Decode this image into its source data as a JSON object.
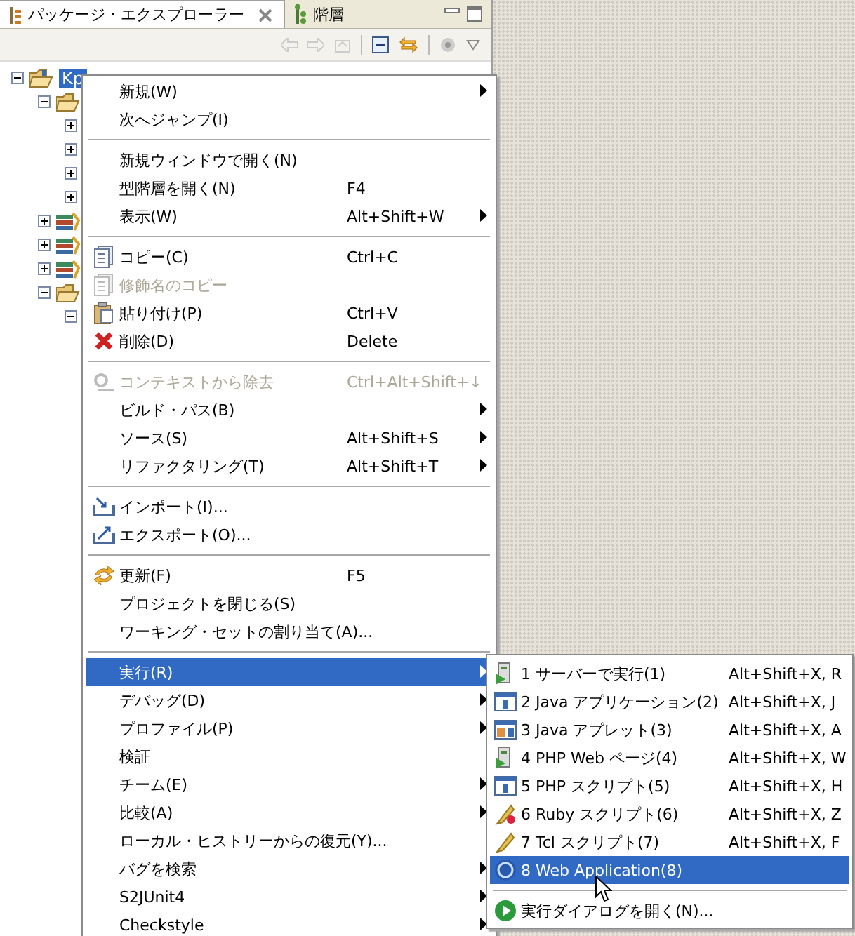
{
  "tabs": [
    {
      "label": "パッケージ・エクスプローラー",
      "selected": true,
      "closable": true
    },
    {
      "label": "階層",
      "selected": false,
      "closable": false
    }
  ],
  "tree": [
    {
      "label": "Kp",
      "kind": "project",
      "expanded": true,
      "selected": true,
      "children": [
        {
          "kind": "folder",
          "expanded": true,
          "children": [
            {
              "expanded": false
            },
            {
              "expanded": false
            },
            {
              "expanded": false
            },
            {
              "expanded": false
            }
          ]
        },
        {
          "kind": "library",
          "expanded": false
        },
        {
          "kind": "library",
          "expanded": false
        },
        {
          "kind": "library",
          "expanded": false
        },
        {
          "kind": "folder",
          "expanded": true,
          "children": [
            {
              "expanded": true
            }
          ]
        }
      ]
    }
  ],
  "context_menu": {
    "items": [
      {
        "kind": "item",
        "label": "新規(W)",
        "submenu": true,
        "disabled": false,
        "selected": false
      },
      {
        "kind": "item",
        "label": "次へジャンプ(I)",
        "submenu": false,
        "disabled": false,
        "selected": false
      },
      {
        "kind": "separator"
      },
      {
        "kind": "item",
        "label": "新規ウィンドウで開く(N)",
        "submenu": false,
        "disabled": false,
        "selected": false
      },
      {
        "kind": "item",
        "label": "型階層を開く(N)",
        "shortcut": "F4",
        "submenu": false,
        "disabled": false,
        "selected": false
      },
      {
        "kind": "item",
        "label": "表示(W)",
        "shortcut": "Alt+Shift+W",
        "submenu": true,
        "disabled": false,
        "selected": false
      },
      {
        "kind": "separator"
      },
      {
        "kind": "item",
        "label": "コピー(C)",
        "shortcut": "Ctrl+C",
        "submenu": false,
        "disabled": false,
        "selected": false
      },
      {
        "kind": "item",
        "label": "修飾名のコピー",
        "submenu": false,
        "disabled": true,
        "selected": false
      },
      {
        "kind": "item",
        "label": "貼り付け(P)",
        "shortcut": "Ctrl+V",
        "submenu": false,
        "disabled": false,
        "selected": false
      },
      {
        "kind": "item",
        "label": "削除(D)",
        "shortcut": "Delete",
        "submenu": false,
        "disabled": false,
        "selected": false
      },
      {
        "kind": "separator"
      },
      {
        "kind": "item",
        "label": "コンテキストから除去",
        "shortcut": "Ctrl+Alt+Shift+↓",
        "submenu": false,
        "disabled": true,
        "selected": false
      },
      {
        "kind": "item",
        "label": "ビルド・パス(B)",
        "submenu": true,
        "disabled": false,
        "selected": false
      },
      {
        "kind": "item",
        "label": "ソース(S)",
        "shortcut": "Alt+Shift+S",
        "submenu": true,
        "disabled": false,
        "selected": false
      },
      {
        "kind": "item",
        "label": "リファクタリング(T)",
        "shortcut": "Alt+Shift+T",
        "submenu": true,
        "disabled": false,
        "selected": false
      },
      {
        "kind": "separator"
      },
      {
        "kind": "item",
        "label": "インポート(I)...",
        "submenu": false,
        "disabled": false,
        "selected": false
      },
      {
        "kind": "item",
        "label": "エクスポート(O)...",
        "submenu": false,
        "disabled": false,
        "selected": false
      },
      {
        "kind": "separator"
      },
      {
        "kind": "item",
        "label": "更新(F)",
        "shortcut": "F5",
        "submenu": false,
        "disabled": false,
        "selected": false
      },
      {
        "kind": "item",
        "label": "プロジェクトを閉じる(S)",
        "submenu": false,
        "disabled": false,
        "selected": false
      },
      {
        "kind": "item",
        "label": "ワーキング・セットの割り当て(A)...",
        "submenu": false,
        "disabled": false,
        "selected": false
      },
      {
        "kind": "separator"
      },
      {
        "kind": "item",
        "label": "実行(R)",
        "submenu": true,
        "disabled": false,
        "selected": true
      },
      {
        "kind": "item",
        "label": "デバッグ(D)",
        "submenu": true,
        "disabled": false,
        "selected": false
      },
      {
        "kind": "item",
        "label": "プロファイル(P)",
        "submenu": true,
        "disabled": false,
        "selected": false
      },
      {
        "kind": "item",
        "label": "検証",
        "submenu": false,
        "disabled": false,
        "selected": false
      },
      {
        "kind": "item",
        "label": "チーム(E)",
        "submenu": true,
        "disabled": false,
        "selected": false
      },
      {
        "kind": "item",
        "label": "比較(A)",
        "submenu": true,
        "disabled": false,
        "selected": false
      },
      {
        "kind": "item",
        "label": "ローカル・ヒストリーからの復元(Y)...",
        "submenu": false,
        "disabled": false,
        "selected": false
      },
      {
        "kind": "item",
        "label": "バグを検索",
        "submenu": true,
        "disabled": false,
        "selected": false
      },
      {
        "kind": "item",
        "label": "S2JUnit4",
        "submenu": true,
        "disabled": false,
        "selected": false
      },
      {
        "kind": "item",
        "label": "Checkstyle",
        "submenu": true,
        "disabled": false,
        "selected": false
      }
    ]
  },
  "run_submenu": {
    "items": [
      {
        "kind": "item",
        "label": "1 サーバーで実行(1)",
        "shortcut": "Alt+Shift+X, R",
        "selected": false
      },
      {
        "kind": "item",
        "label": "2 Java アプリケーション(2)",
        "shortcut": "Alt+Shift+X, J",
        "selected": false
      },
      {
        "kind": "item",
        "label": "3 Java アプレット(3)",
        "shortcut": "Alt+Shift+X, A",
        "selected": false
      },
      {
        "kind": "item",
        "label": "4 PHP Web ページ(4)",
        "shortcut": "Alt+Shift+X, W",
        "selected": false
      },
      {
        "kind": "item",
        "label": "5 PHP スクリプト(5)",
        "shortcut": "Alt+Shift+X, H",
        "selected": false
      },
      {
        "kind": "item",
        "label": "6 Ruby スクリプト(6)",
        "shortcut": "Alt+Shift+X, Z",
        "selected": false
      },
      {
        "kind": "item",
        "label": "7 Tcl スクリプト(7)",
        "shortcut": "Alt+Shift+X, F",
        "selected": false
      },
      {
        "kind": "item",
        "label": "8 Web Application(8)",
        "selected": true
      },
      {
        "kind": "separator"
      },
      {
        "kind": "item",
        "label": "実行ダイアログを開く(N)...",
        "selected": false
      }
    ]
  }
}
